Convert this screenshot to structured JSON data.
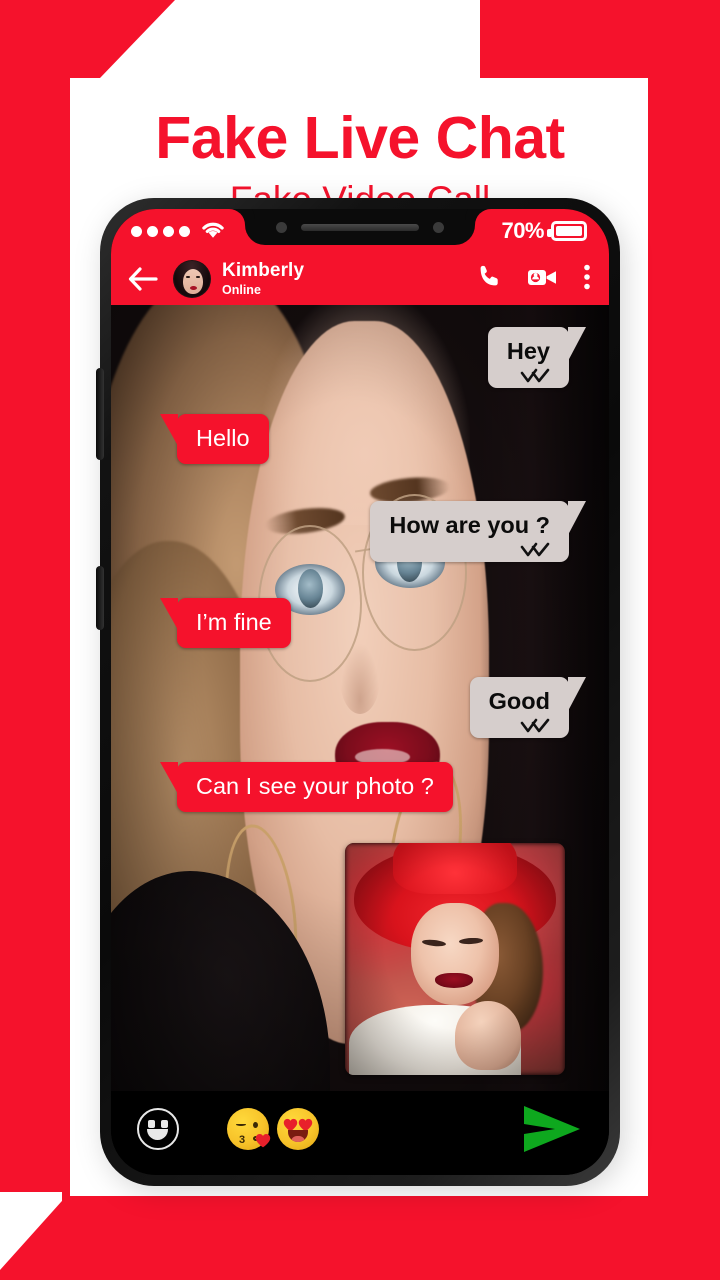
{
  "poster": {
    "title": "Fake Live Chat",
    "subtitle": "Fake Video Call",
    "brand_color": "#F5122C",
    "frame_color": "#F5122C"
  },
  "phone": {
    "status_bar": {
      "signal_dots": 4,
      "wifi_icon": "wifi-icon",
      "battery_percent": "70%",
      "battery_icon": "battery-icon"
    },
    "app_bar": {
      "back_icon": "back-arrow-icon",
      "avatar": "contact-avatar",
      "contact_name": "Kimberly",
      "contact_status": "Online",
      "call_icon": "phone-call-icon",
      "video_icon": "video-call-icon",
      "menu_icon": "overflow-menu-icon",
      "background_color": "#F5122C"
    },
    "chat": {
      "incoming_bubble_color": "#D6CECC",
      "outgoing_bubble_color": "#F5122C",
      "messages": [
        {
          "id": "m1",
          "text": "Hey",
          "side": "them",
          "ticks": true
        },
        {
          "id": "m2",
          "text": "Hello",
          "side": "me",
          "ticks": false
        },
        {
          "id": "m3",
          "text": "How are you ?",
          "side": "them",
          "ticks": true
        },
        {
          "id": "m4",
          "text": "I’m fine",
          "side": "me",
          "ticks": false
        },
        {
          "id": "m5",
          "text": "Good",
          "side": "them",
          "ticks": true
        },
        {
          "id": "m6",
          "text": "Can I see your photo ?",
          "side": "me",
          "ticks": false
        }
      ],
      "photo_attachment": {
        "name": "photo-attachment",
        "description": "Woman wearing a red hat"
      }
    },
    "input_bar": {
      "emoji_button_icon": "smiley-outline-icon",
      "quick_emojis": [
        {
          "name": "kissing-heart-emoji",
          "glyph": "😘"
        },
        {
          "name": "heart-eyes-emoji",
          "glyph": "😍"
        }
      ],
      "send_button_icon": "send-arrow-icon",
      "send_button_color": "#0EA81E",
      "background_color": "#000000"
    }
  }
}
